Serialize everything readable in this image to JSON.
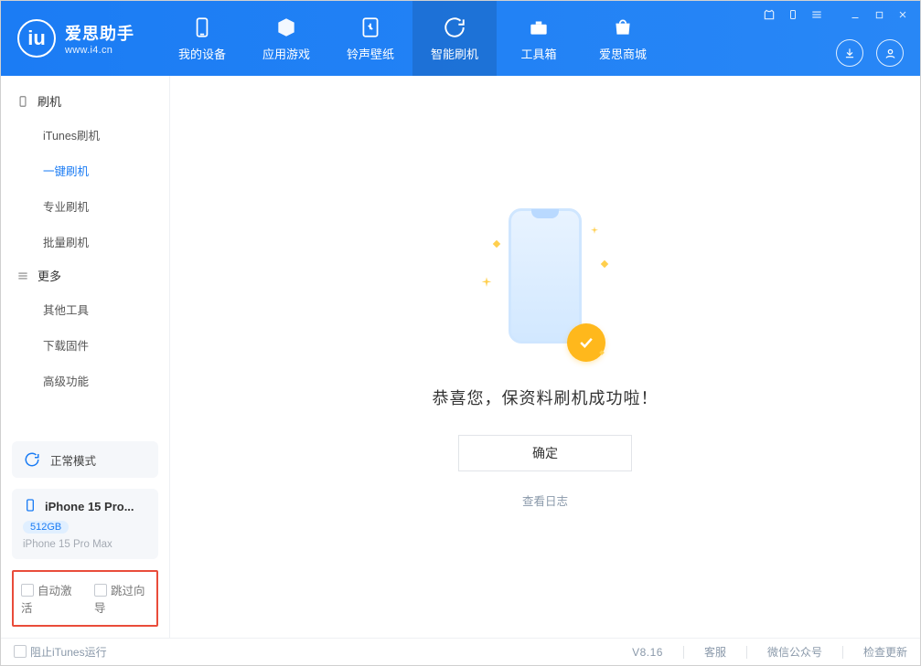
{
  "app": {
    "title": "爱思助手",
    "url": "www.i4.cn"
  },
  "nav": [
    {
      "id": "device",
      "label": "我的设备"
    },
    {
      "id": "apps",
      "label": "应用游戏"
    },
    {
      "id": "ring",
      "label": "铃声壁纸"
    },
    {
      "id": "flash",
      "label": "智能刷机",
      "active": true
    },
    {
      "id": "tools",
      "label": "工具箱"
    },
    {
      "id": "store",
      "label": "爱思商城"
    }
  ],
  "sidebar": {
    "groups": [
      {
        "title": "刷机",
        "icon": "phone-icon",
        "items": [
          "iTunes刷机",
          "一键刷机",
          "专业刷机",
          "批量刷机"
        ],
        "activeIndex": 1
      },
      {
        "title": "更多",
        "icon": "menu-icon",
        "items": [
          "其他工具",
          "下载固件",
          "高级功能"
        ]
      }
    ],
    "mode": {
      "label": "正常模式"
    },
    "device": {
      "name": "iPhone 15 Pro...",
      "storage": "512GB",
      "model": "iPhone 15 Pro Max"
    },
    "options": {
      "autoActivate": "自动激活",
      "skipGuide": "跳过向导"
    }
  },
  "main": {
    "successText": "恭喜您，保资料刷机成功啦！",
    "okLabel": "确定",
    "logLink": "查看日志"
  },
  "footer": {
    "blockItunes": "阻止iTunes运行",
    "version": "V8.16",
    "support": "客服",
    "wechat": "微信公众号",
    "update": "检查更新"
  }
}
